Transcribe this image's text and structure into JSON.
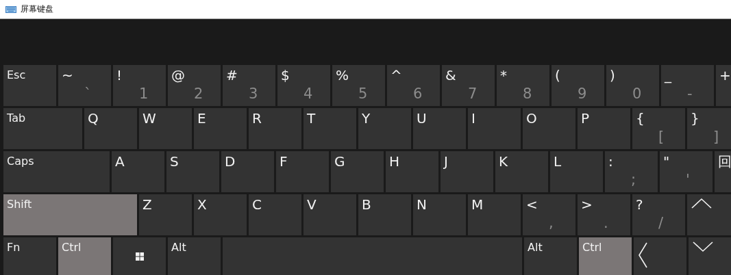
{
  "window": {
    "title": "屏幕键盘"
  },
  "rows": [
    {
      "keys": [
        {
          "kind": "char",
          "label": "Esc",
          "pressed": false
        },
        {
          "kind": "char",
          "label": "~",
          "sub": "`",
          "pressed": false
        },
        {
          "kind": "char",
          "label": "!",
          "sub": "1",
          "pressed": false
        },
        {
          "kind": "char",
          "label": "@",
          "sub": "2",
          "pressed": false
        },
        {
          "kind": "char",
          "label": "#",
          "sub": "3",
          "pressed": false
        },
        {
          "kind": "char",
          "label": "$",
          "sub": "4",
          "pressed": false
        },
        {
          "kind": "char",
          "label": "%",
          "sub": "5",
          "pressed": false
        },
        {
          "kind": "char",
          "label": "^",
          "sub": "6",
          "pressed": false
        },
        {
          "kind": "char",
          "label": "&",
          "sub": "7",
          "pressed": false
        },
        {
          "kind": "char",
          "label": "*",
          "sub": "8",
          "pressed": false
        },
        {
          "kind": "char",
          "label": "(",
          "sub": "9",
          "pressed": false
        },
        {
          "kind": "char",
          "label": ")",
          "sub": "0",
          "pressed": false
        },
        {
          "kind": "char",
          "label": "_",
          "sub": "-",
          "pressed": false
        },
        {
          "kind": "char",
          "label": "+",
          "pressed": false
        }
      ]
    },
    {
      "keys": [
        {
          "kind": "tab",
          "label": "Tab",
          "pressed": false
        },
        {
          "kind": "char",
          "label": "Q",
          "pressed": false
        },
        {
          "kind": "char",
          "label": "W",
          "pressed": false
        },
        {
          "kind": "char",
          "label": "E",
          "pressed": false
        },
        {
          "kind": "char",
          "label": "R",
          "pressed": false
        },
        {
          "kind": "char",
          "label": "T",
          "pressed": false
        },
        {
          "kind": "char",
          "label": "Y",
          "pressed": false
        },
        {
          "kind": "char",
          "label": "U",
          "pressed": false
        },
        {
          "kind": "char",
          "label": "I",
          "pressed": false
        },
        {
          "kind": "char",
          "label": "O",
          "pressed": false
        },
        {
          "kind": "char",
          "label": "P",
          "pressed": false
        },
        {
          "kind": "char",
          "label": "{",
          "sub": "[",
          "pressed": false
        },
        {
          "kind": "char",
          "label": "}",
          "sub": "]",
          "pressed": false
        }
      ]
    },
    {
      "keys": [
        {
          "kind": "caps",
          "label": "Caps",
          "pressed": false
        },
        {
          "kind": "char",
          "label": "A",
          "pressed": false
        },
        {
          "kind": "char",
          "label": "S",
          "pressed": false
        },
        {
          "kind": "char",
          "label": "D",
          "pressed": false
        },
        {
          "kind": "char",
          "label": "F",
          "pressed": false
        },
        {
          "kind": "char",
          "label": "G",
          "pressed": false
        },
        {
          "kind": "char",
          "label": "H",
          "pressed": false
        },
        {
          "kind": "char",
          "label": "J",
          "pressed": false
        },
        {
          "kind": "char",
          "label": "K",
          "pressed": false
        },
        {
          "kind": "char",
          "label": "L",
          "pressed": false
        },
        {
          "kind": "char",
          "label": ":",
          "sub": ";",
          "pressed": false
        },
        {
          "kind": "char",
          "label": "\"",
          "sub": "'",
          "pressed": false
        },
        {
          "kind": "char",
          "label": "回",
          "pressed": false
        }
      ]
    },
    {
      "keys": [
        {
          "kind": "shift",
          "label": "Shift",
          "pressed": true
        },
        {
          "kind": "char",
          "label": "Z",
          "pressed": false
        },
        {
          "kind": "char",
          "label": "X",
          "pressed": false
        },
        {
          "kind": "char",
          "label": "C",
          "pressed": false
        },
        {
          "kind": "char",
          "label": "V",
          "pressed": false
        },
        {
          "kind": "char",
          "label": "B",
          "pressed": false
        },
        {
          "kind": "char",
          "label": "N",
          "pressed": false
        },
        {
          "kind": "char",
          "label": "M",
          "pressed": false
        },
        {
          "kind": "char",
          "label": "<",
          "sub": ",",
          "pressed": false
        },
        {
          "kind": "char",
          "label": ">",
          "sub": ".",
          "pressed": false
        },
        {
          "kind": "char",
          "label": "?",
          "sub": "/",
          "pressed": false
        },
        {
          "kind": "up",
          "pressed": false
        }
      ]
    },
    {
      "keys": [
        {
          "kind": "char",
          "label": "Fn",
          "pressed": false
        },
        {
          "kind": "char",
          "label": "Ctrl",
          "pressed": true
        },
        {
          "kind": "windows",
          "pressed": false
        },
        {
          "kind": "char",
          "label": "Alt",
          "pressed": false
        },
        {
          "kind": "space",
          "pressed": false
        },
        {
          "kind": "char",
          "label": "Alt",
          "pressed": false
        },
        {
          "kind": "char",
          "label": "Ctrl",
          "pressed": true
        },
        {
          "kind": "left",
          "pressed": false
        },
        {
          "kind": "down",
          "pressed": false
        }
      ]
    }
  ]
}
